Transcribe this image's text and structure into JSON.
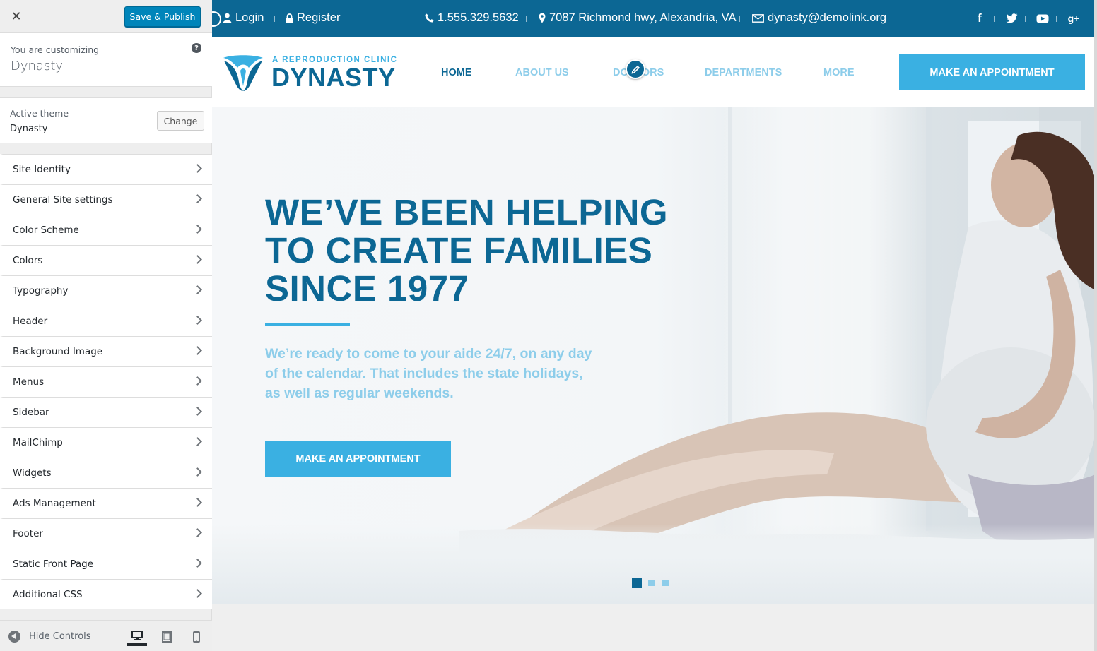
{
  "customizer": {
    "close_label": "✕",
    "save_label": "Save & Publish",
    "customizing_label": "You are customizing",
    "site_name": "Dynasty",
    "help_label": "?",
    "active_theme_label": "Active theme",
    "active_theme": "Dynasty",
    "change_label": "Change",
    "panels": [
      {
        "label": "Site Identity"
      },
      {
        "label": "General Site settings"
      },
      {
        "label": "Color Scheme"
      },
      {
        "label": "Colors"
      },
      {
        "label": "Typography"
      },
      {
        "label": "Header"
      },
      {
        "label": "Background Image"
      },
      {
        "label": "Menus"
      },
      {
        "label": "Sidebar"
      },
      {
        "label": "MailChimp"
      },
      {
        "label": "Widgets"
      },
      {
        "label": "Ads Management"
      },
      {
        "label": "Footer"
      },
      {
        "label": "Static Front Page"
      },
      {
        "label": "Additional CSS"
      }
    ],
    "hide_controls_label": "Hide Controls",
    "devices": [
      "desktop-icon",
      "tablet-icon",
      "mobile-icon"
    ],
    "active_device": "desktop"
  },
  "site": {
    "topbar": {
      "login": "Login",
      "register": "Register",
      "phone": "1.555.329.5632",
      "address": "7087 Richmond hwy, Alexandria, VA",
      "email": "dynasty@demolink.org",
      "social": [
        "facebook-icon",
        "twitter-icon",
        "youtube-icon",
        "google-plus-icon"
      ],
      "social_glyphs": {
        "facebook": "f",
        "google_plus": "g+"
      }
    },
    "logo": {
      "tagline": "A REPRODUCTION CLINIC",
      "name": "DYNASTY"
    },
    "nav": {
      "home": "HOME",
      "about": "ABOUT US",
      "doctors": "DOCTORS",
      "departments": "DEPARTMENTS",
      "more": "MORE",
      "active": "home"
    },
    "header_cta": "MAKE AN APPOINTMENT",
    "hero": {
      "title": "WE’VE BEEN HELPING\nTO CREATE FAMILIES\nSINCE 1977",
      "text": "We’re ready to come to your aide 24/7, on any day of the calendar. That includes the state holidays, as well as regular weekends.",
      "cta": "MAKE AN APPOINTMENT",
      "slides": 3,
      "active_slide": 1
    },
    "colors": {
      "primary_dark": "#0c6794",
      "accent": "#3ab0e2",
      "light_accent": "#8dcdea",
      "customizer_button": "#0085ba"
    }
  }
}
